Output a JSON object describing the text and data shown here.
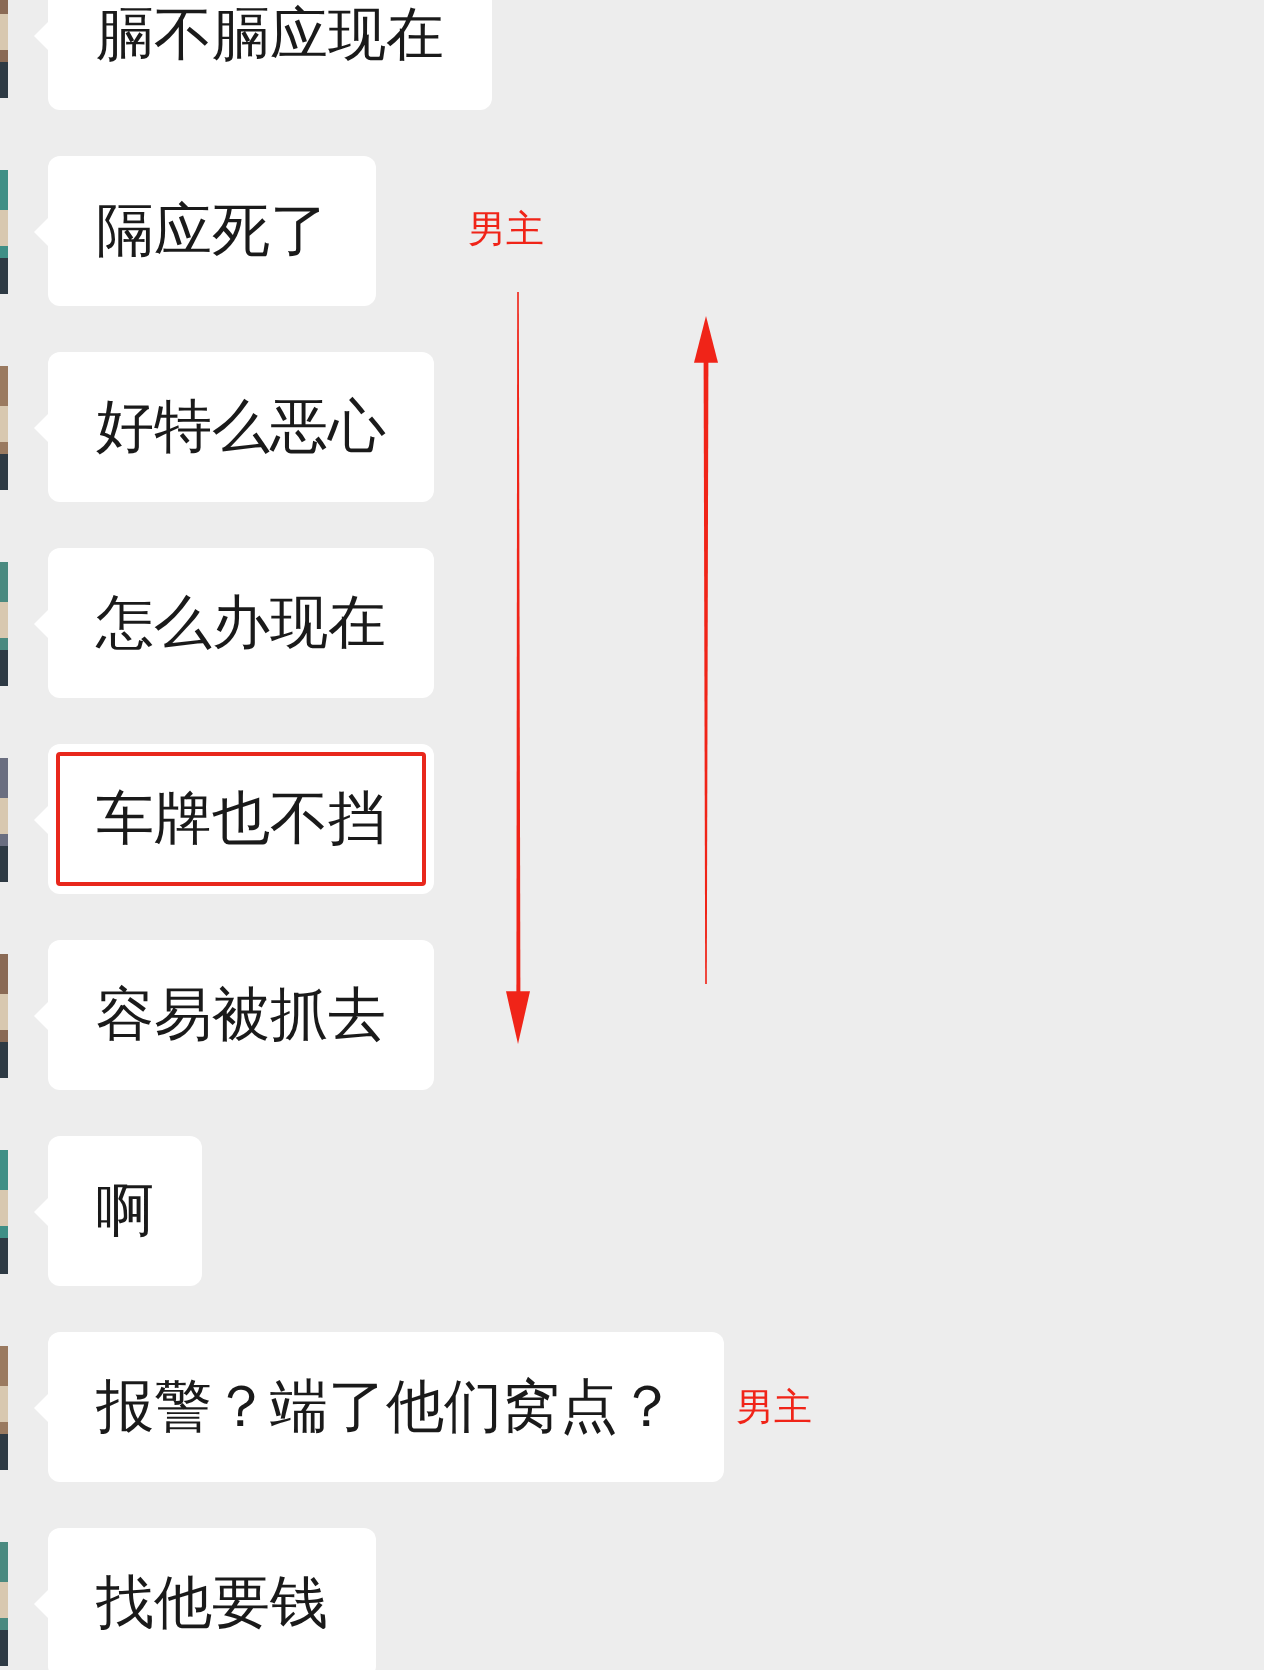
{
  "messages": [
    {
      "text": "膈不膈应现在",
      "highlighted": false
    },
    {
      "text": "隔应死了",
      "highlighted": false,
      "note": "男主"
    },
    {
      "text": "好特么恶心",
      "highlighted": false
    },
    {
      "text": "怎么办现在",
      "highlighted": false
    },
    {
      "text": "车牌也不挡",
      "highlighted": true
    },
    {
      "text": "容易被抓去",
      "highlighted": false
    },
    {
      "text": "啊",
      "highlighted": false
    },
    {
      "text": "报警？端了他们窝点？",
      "highlighted": false,
      "note": "男主"
    },
    {
      "text": "找他要钱",
      "highlighted": false
    }
  ],
  "arrows": [
    {
      "kind": "down"
    },
    {
      "kind": "up"
    }
  ]
}
